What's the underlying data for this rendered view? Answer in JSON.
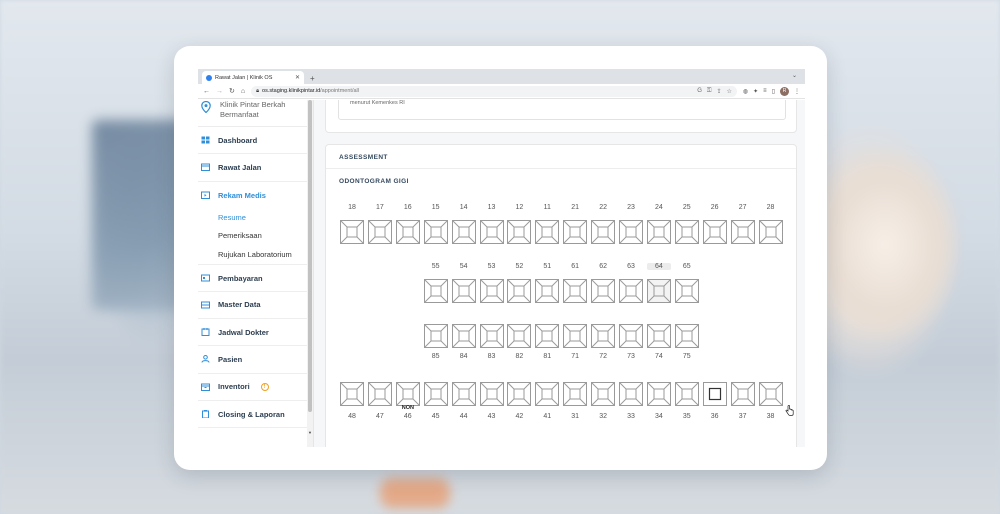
{
  "browser": {
    "tab_title": "Rawat Jalan | Klinik OS",
    "new_tab": "+",
    "url_host": "os.staging.klinikpintar.id",
    "url_path": "/appointment/all",
    "profile_initial": "R"
  },
  "sidebar": {
    "clinic_name": "Klinik Pintar Berkah Bermanfaat",
    "items": [
      {
        "label": "Dashboard"
      },
      {
        "label": "Rawat Jalan"
      },
      {
        "label": "Rekam Medis"
      },
      {
        "label": "Pembayaran"
      },
      {
        "label": "Master Data"
      },
      {
        "label": "Jadwal Dokter"
      },
      {
        "label": "Pasien"
      },
      {
        "label": "Inventori"
      },
      {
        "label": "Closing & Laporan"
      }
    ],
    "submenu": [
      {
        "label": "Resume"
      },
      {
        "label": "Pemeriksaan"
      },
      {
        "label": "Rujukan Laboratorium"
      }
    ],
    "inventori_badge": "!"
  },
  "prev_card": {
    "text": "menurut Kemenkes RI"
  },
  "assessment": {
    "heading": "ASSESSMENT",
    "odontogram_title": "ODONTOGRAM GIGI",
    "row1": [
      "18",
      "17",
      "16",
      "15",
      "14",
      "13",
      "12",
      "11",
      "21",
      "22",
      "23",
      "24",
      "25",
      "26",
      "27",
      "28"
    ],
    "row2": [
      "55",
      "54",
      "53",
      "52",
      "51",
      "61",
      "62",
      "63",
      "64",
      "65"
    ],
    "row3": [
      "85",
      "84",
      "83",
      "82",
      "81",
      "71",
      "72",
      "73",
      "74",
      "75"
    ],
    "row4": [
      "48",
      "47",
      "46",
      "45",
      "44",
      "43",
      "42",
      "41",
      "31",
      "32",
      "33",
      "34",
      "35",
      "36",
      "37",
      "38"
    ],
    "non_label": "NON",
    "highlighted_tooth": "64",
    "missing_tooth": "36"
  }
}
